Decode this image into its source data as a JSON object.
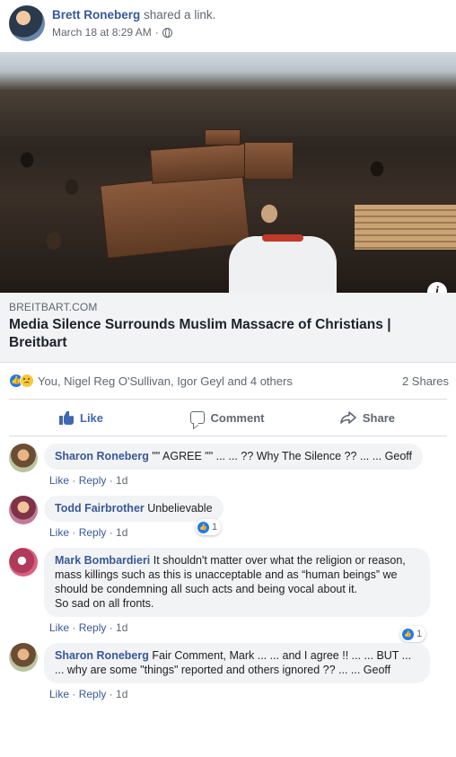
{
  "post": {
    "author": "Brett Roneberg",
    "action": "shared a link.",
    "timestamp": "March 18 at 8:29 AM"
  },
  "link": {
    "domain": "BREITBART.COM",
    "title": "Media Silence Surrounds Muslim Massacre of Christians | Breitbart"
  },
  "reactions": {
    "summary": "You, Nigel Reg O'Sullivan, Igor Geyl and 4 others",
    "shares": "2 Shares"
  },
  "actions": {
    "like": "Like",
    "comment": "Comment",
    "share": "Share"
  },
  "comments": [
    {
      "author": "Sharon Roneberg",
      "text": "\"\" AGREE \"\" ... ... ?? Why The Silence ?? ... ... Geoff",
      "like": "Like",
      "reply": "Reply",
      "age": "1d"
    },
    {
      "author": "Todd Fairbrother",
      "text": "Unbelievable",
      "like": "Like",
      "reply": "Reply",
      "age": "1d",
      "reaction_count": "1"
    },
    {
      "author": "Mark Bombardieri",
      "text": "It shouldn't matter over what the religion or reason, mass killings such as this is unacceptable and as “human beings” we should be condemning all such acts and being vocal about it.",
      "text2": "So sad on all fronts.",
      "like": "Like",
      "reply": "Reply",
      "age": "1d",
      "reaction_count": "1"
    },
    {
      "author": "Sharon Roneberg",
      "text": "Fair Comment, Mark ... ... and I agree !! ... ... BUT ... ... why are some \"things\" reported and others ignored ?? ... ... Geoff",
      "like": "Like",
      "reply": "Reply",
      "age": "1d"
    }
  ],
  "colors": {
    "link_blue": "#385898",
    "like_blue": "#4267b2",
    "reaction_blue": "#2078f4",
    "bubble_gray": "#f2f3f5"
  }
}
